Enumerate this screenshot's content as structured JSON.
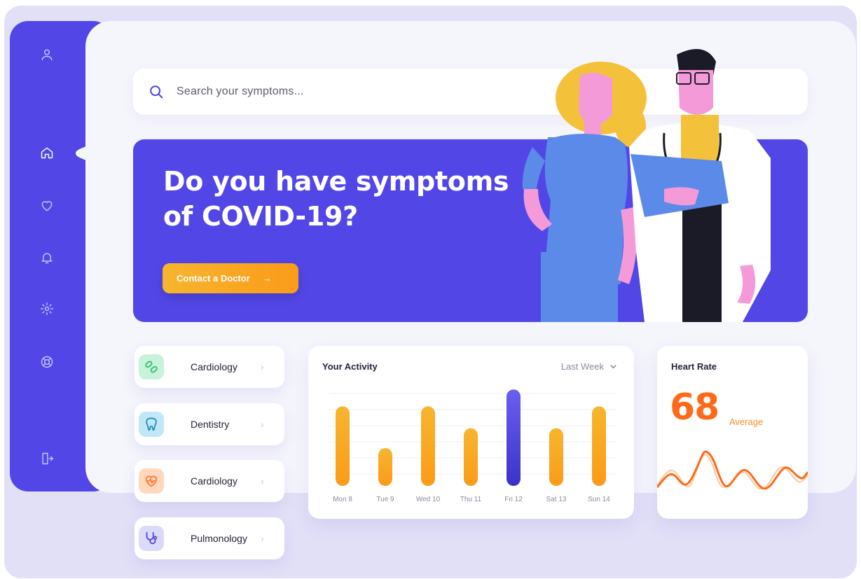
{
  "app": {
    "colors": {
      "accent": "#5247e6",
      "cta": "#fb9b1a",
      "heart": "#ff6a1a",
      "active_bar": "#4b41dd",
      "bar": "#f7a91f"
    }
  },
  "sidebar": {
    "items": [
      {
        "icon": "user-icon",
        "active": false
      },
      {
        "icon": "home-icon",
        "active": true
      },
      {
        "icon": "heart-icon",
        "active": false
      },
      {
        "icon": "bell-icon",
        "active": false
      },
      {
        "icon": "gear-icon",
        "active": false
      },
      {
        "icon": "lifebuoy-icon",
        "active": false
      },
      {
        "icon": "logout-icon",
        "active": false
      }
    ]
  },
  "search": {
    "placeholder": "Search your symptoms..."
  },
  "hero": {
    "title_line1": "Do you have symptoms",
    "title_line2": "of COVID-19?",
    "cta_label": "Contact a Doctor",
    "cta_arrow": "→"
  },
  "categories": [
    {
      "label": "Cardiology",
      "icon": "pills-icon",
      "color": "#2fbf71",
      "bg": "#c8f2d9"
    },
    {
      "label": "Dentistry",
      "icon": "tooth-icon",
      "color": "#1f8fc7",
      "bg": "#c2e8f7"
    },
    {
      "label": "Cardiology",
      "icon": "heartbeat-icon",
      "color": "#ff7a2a",
      "bg": "#ffd8bd"
    },
    {
      "label": "Pulmonology",
      "icon": "stethoscope-icon",
      "color": "#5247e6",
      "bg": "#dcdafb"
    }
  ],
  "activity": {
    "title": "Your Activity",
    "range": "Last Week"
  },
  "chart_data": {
    "type": "bar",
    "categories": [
      "Mon 8",
      "Tue 9",
      "Wed 10",
      "Thu 11",
      "Fri 12",
      "Sat 13",
      "Sun 14"
    ],
    "values": [
      0.8,
      0.38,
      0.8,
      0.58,
      0.97,
      0.58,
      0.8
    ],
    "highlighted": "Fri 12",
    "title": "Your Activity",
    "xlabel": "",
    "ylabel": "",
    "ylim": [
      0,
      1
    ]
  },
  "heart_rate": {
    "title": "Heart Rate",
    "value": "68",
    "unit": "Average"
  }
}
